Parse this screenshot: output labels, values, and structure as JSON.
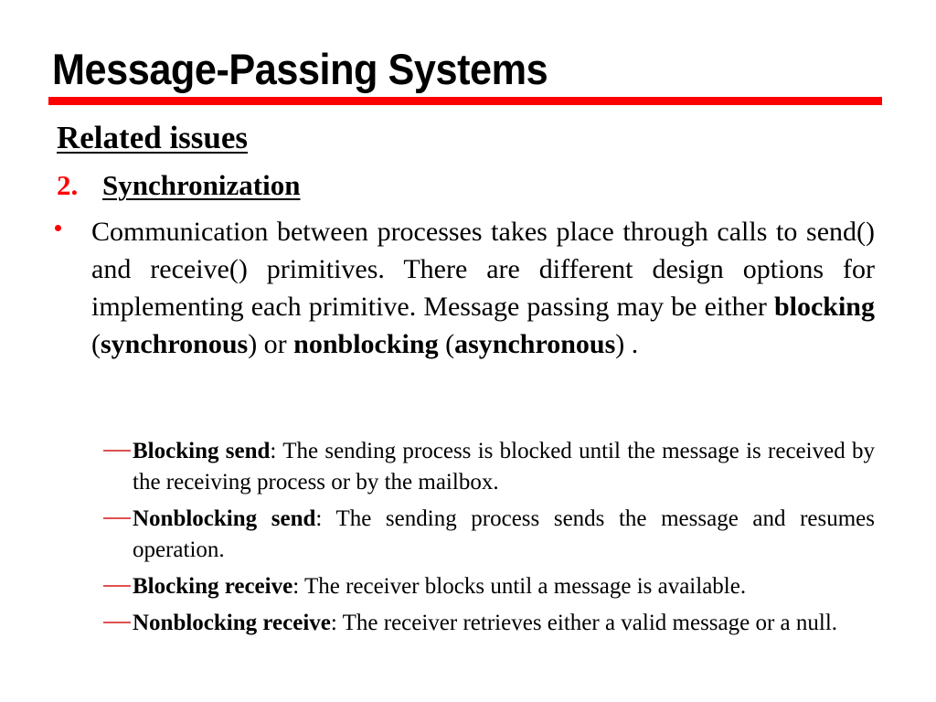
{
  "slide": {
    "title": "Message-Passing Systems",
    "accent_color": "#ff0000",
    "subheading": "Related issues",
    "numbered_item": {
      "number": "2.",
      "label": "Synchronization"
    },
    "bullet": {
      "part1": "Communication between processes takes place through calls to send() and receive() primitives. There are different design options for implementing each primitive. Message passing may be either ",
      "bold1": "blocking",
      "part2": " (",
      "bold2": "synchronous",
      "part3": ") or ",
      "bold3": "nonblocking",
      "part4": " (",
      "bold4": "asynchronous",
      "part5": ") ."
    },
    "subitems": [
      {
        "term": "Blocking send",
        "desc": ": The sending process is blocked until the message is received by the receiving process or by the mailbox."
      },
      {
        "term": "Nonblocking send",
        "desc": ": The sending process sends the message and resumes operation."
      },
      {
        "term": "Blocking receive",
        "desc": ": The receiver blocks until a message is available."
      },
      {
        "term": "Nonblocking receive",
        "desc": ": The receiver retrieves either a valid message or a null."
      }
    ]
  }
}
